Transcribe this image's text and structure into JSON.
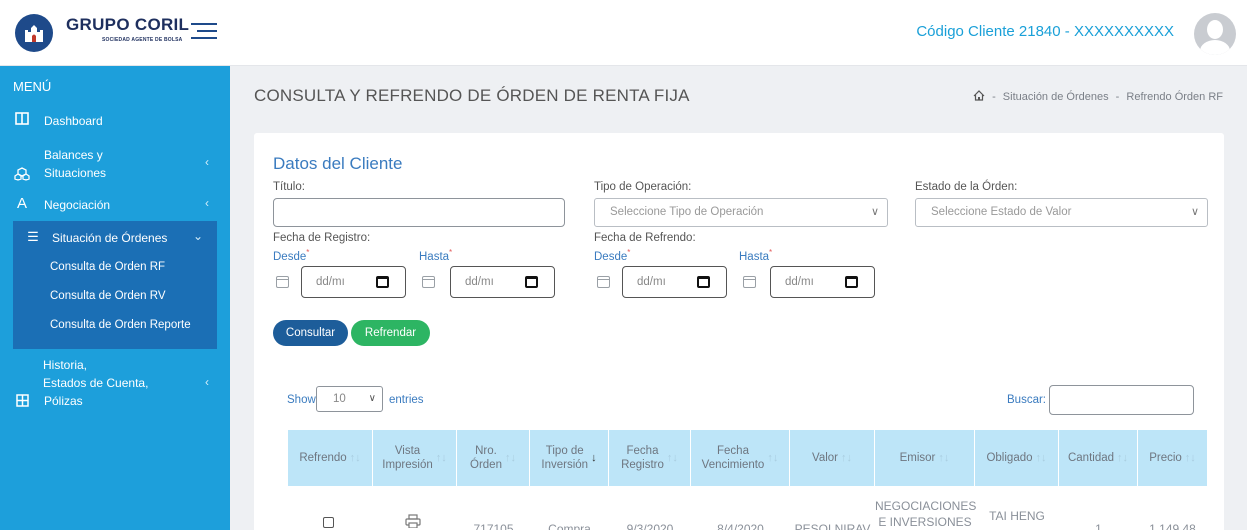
{
  "header": {
    "brand": "GRUPO CORIL",
    "brand_sub": "SOCIEDAD AGENTE DE BOLSA",
    "client_code": "Código Cliente 21840 - XXXXXXXXXX"
  },
  "sidebar": {
    "menu_title": "MENÚ",
    "items": [
      {
        "label": "Dashboard",
        "icon": "columns-icon"
      },
      {
        "label_line1": "Balances y",
        "label_line2": "Situaciones",
        "icon": "cubes-icon"
      },
      {
        "label": "Negociación",
        "icon": "letter-a-icon"
      },
      {
        "label": "Situación de Órdenes",
        "icon": "list-icon"
      },
      {
        "label_line1": "Historia,",
        "label_line2": "Estados de Cuenta,",
        "label_line3": "Pólizas",
        "icon": "grid-icon"
      }
    ],
    "subitems": [
      "Consulta de Orden RF",
      "Consulta de Orden RV",
      "Consulta de Orden Reporte"
    ]
  },
  "page": {
    "title": "CONSULTA Y REFRENDO DE ÓRDEN DE RENTA FIJA",
    "breadcrumb": [
      "Situación de Órdenes",
      "Refrendo Órden RF"
    ],
    "breadcrumb_sep": "-"
  },
  "form": {
    "section_title": "Datos del Cliente",
    "titulo_label": "Título:",
    "tipo_op_label": "Tipo de Operación:",
    "tipo_op_placeholder": "Seleccione Tipo de Operación",
    "estado_label": "Estado de la Órden:",
    "estado_placeholder": "Seleccione Estado de Valor",
    "fecha_registro_label": "Fecha de Registro:",
    "fecha_refrendo_label": "Fecha de Refrendo:",
    "desde_label": "Desde",
    "hasta_label": "Hasta",
    "required_mark": "*",
    "date_placeholder": "dd/mı",
    "consultar_label": "Consultar",
    "refrendar_label": "Refrendar"
  },
  "table": {
    "show_label": "Show",
    "entries_value": "10",
    "entries_label": "entries",
    "search_label": "Buscar:",
    "columns": [
      {
        "line1": "Refrendo",
        "line2": ""
      },
      {
        "line1": "Vista",
        "line2": "Impresión"
      },
      {
        "line1": "Nro.",
        "line2": "Órden"
      },
      {
        "line1": "Tipo de",
        "line2": "Inversión"
      },
      {
        "line1": "Fecha",
        "line2": "Registro"
      },
      {
        "line1": "Fecha",
        "line2": "Vencimiento"
      },
      {
        "line1": "Valor",
        "line2": ""
      },
      {
        "line1": "Emisor",
        "line2": ""
      },
      {
        "line1": "Obligado",
        "line2": ""
      },
      {
        "line1": "Cantidad",
        "line2": ""
      },
      {
        "line1": "Precio",
        "line2": ""
      }
    ],
    "sort_icon": "↑↓",
    "active_sort_icon": "↓",
    "row1": {
      "nro_orden": "717105",
      "tipo": "Compra",
      "fecha_registro": "9/3/2020",
      "fecha_vencimiento": "8/4/2020",
      "valor": "PESOLNIRAV",
      "emisor_line1": "NEGOCIACIONES",
      "emisor_line2": "E INVERSIONES",
      "obligado": "TAI HENG",
      "cantidad": "1",
      "precio": "1.149.48"
    }
  },
  "colors": {
    "sidebar_bg": "#1d9fdb",
    "submenu_bg": "#1b6fb5",
    "accent_blue": "#3a7bbf",
    "client_code": "#1aa0d8",
    "consultar_btn": "#1d5d9a",
    "refrendar_btn": "#2db563",
    "table_header": "#bde5f8"
  }
}
